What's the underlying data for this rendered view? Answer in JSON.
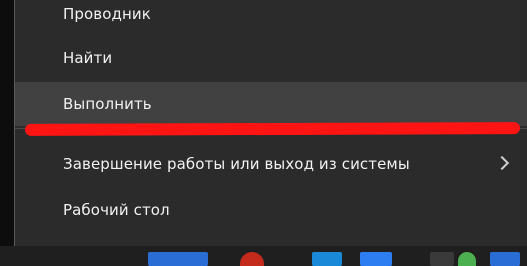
{
  "context_menu": {
    "items": [
      {
        "label": "Проводник",
        "has_submenu": false
      },
      {
        "label": "Найти",
        "has_submenu": false
      },
      {
        "label": "Выполнить",
        "has_submenu": false,
        "highlighted": true
      },
      {
        "label": "Завершение работы или выход из системы",
        "has_submenu": true,
        "submenu_icon": "chevron-right-icon"
      },
      {
        "label": "Рабочий стол",
        "has_submenu": false
      }
    ]
  },
  "annotation": {
    "type": "red-underline",
    "color": "#ff1414",
    "target_item": "Выполнить"
  },
  "colors": {
    "menu_background": "#2b2b2b",
    "menu_hover": "#414141",
    "menu_text": "#f2f2f2",
    "page_background": "#d7d7d7"
  },
  "taskbar": {
    "icons": [
      "app-icon",
      "app-icon",
      "app-icon",
      "app-icon",
      "app-icon",
      "app-icon",
      "app-icon"
    ]
  }
}
